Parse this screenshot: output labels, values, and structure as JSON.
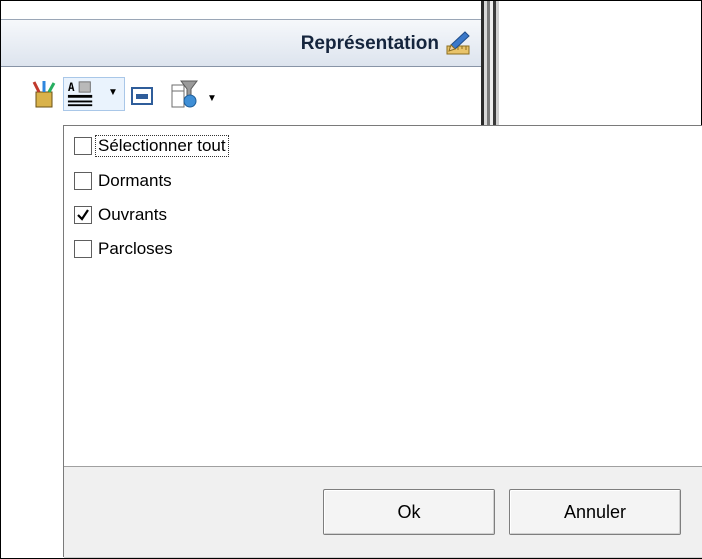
{
  "panel": {
    "title": "Représentation"
  },
  "toolbar": {
    "items": [
      {
        "icon": "paint-brushes-icon"
      },
      {
        "icon": "text-format-icon",
        "dropdown": true
      },
      {
        "icon": "frame-icon"
      },
      {
        "icon": "filter-icon",
        "dropdown": true
      }
    ]
  },
  "popup": {
    "items": [
      {
        "label": "Sélectionner tout",
        "checked": false,
        "focused": true
      },
      {
        "label": "Dormants",
        "checked": false,
        "focused": false
      },
      {
        "label": "Ouvrants",
        "checked": true,
        "focused": false
      },
      {
        "label": "Parcloses",
        "checked": false,
        "focused": false
      }
    ],
    "ok_label": "Ok",
    "cancel_label": "Annuler"
  },
  "colors": {
    "header_text": "#15253d",
    "popup_border": "#7a7a7a",
    "footer_bg": "#f0f0f0"
  }
}
